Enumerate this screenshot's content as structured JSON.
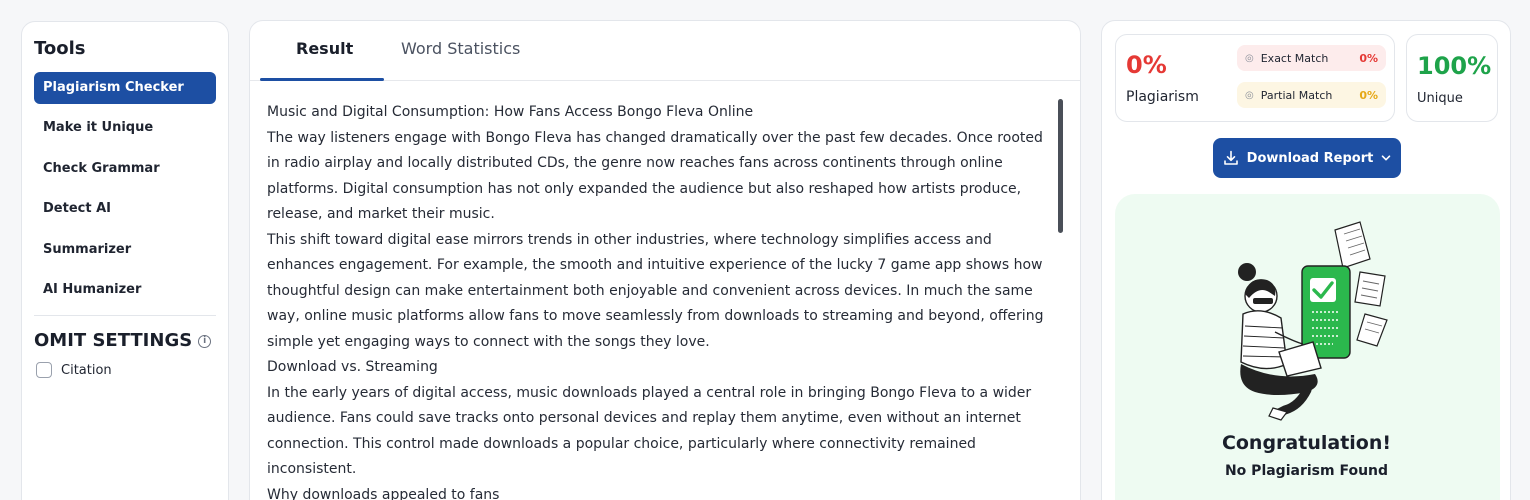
{
  "tools": {
    "heading": "Tools",
    "items": [
      {
        "label": "Plagiarism Checker",
        "active": true
      },
      {
        "label": "Make it Unique",
        "active": false
      },
      {
        "label": "Check Grammar",
        "active": false
      },
      {
        "label": "Detect AI",
        "active": false
      },
      {
        "label": "Summarizer",
        "active": false
      },
      {
        "label": "AI Humanizer",
        "active": false
      }
    ],
    "omit_heading": "OMIT SETTINGS",
    "citation_label": "Citation",
    "citation_checked": false
  },
  "result": {
    "tabs": [
      {
        "label": "Result",
        "active": true
      },
      {
        "label": "Word Statistics",
        "active": false
      }
    ],
    "paragraphs": [
      "Music and Digital Consumption: How Fans Access Bongo Fleva Online",
      "The way listeners engage with Bongo Fleva has changed dramatically over the past few decades. Once rooted in radio airplay and locally distributed CDs, the genre now reaches fans across continents through online platforms. Digital consumption has not only expanded the audience but also reshaped how artists produce, release, and market their music.",
      "This shift toward digital ease mirrors trends in other industries, where technology simplifies access and enhances engagement. For example, the smooth and intuitive experience of the lucky 7 game app shows how thoughtful design can make entertainment both enjoyable and convenient across devices. In much the same way, online music platforms allow fans to move seamlessly from downloads to streaming and beyond, offering simple yet engaging ways to connect with the songs they love.",
      "Download vs. Streaming",
      "In the early years of digital access, music downloads played a central role in bringing Bongo Fleva to a wider audience. Fans could save tracks onto personal devices and replay them anytime, even without an internet connection. This control made downloads a popular choice, particularly where connectivity remained inconsistent.",
      "Why downloads appealed to fans"
    ]
  },
  "report": {
    "plagiarism_pct": "0%",
    "plagiarism_label": "Plagiarism",
    "exact_label": "Exact Match",
    "exact_pct": "0%",
    "partial_label": "Partial Match",
    "partial_pct": "0%",
    "unique_pct": "100%",
    "unique_label": "Unique",
    "download_label": "Download Report",
    "congrats_title": "Congratulation!",
    "congrats_sub": "No Plagiarism Found"
  },
  "colors": {
    "primary": "#1d4fa3",
    "plagiarism": "#e53935",
    "partial": "#e6a817",
    "unique": "#1ea34a",
    "congrats_bg": "#eefbf2"
  },
  "icons": {
    "info": "info-icon",
    "eye": "eye-icon",
    "download": "download-icon",
    "chevron": "chevron-down-icon",
    "illustration": "person-laptop-checkmark-illustration"
  }
}
